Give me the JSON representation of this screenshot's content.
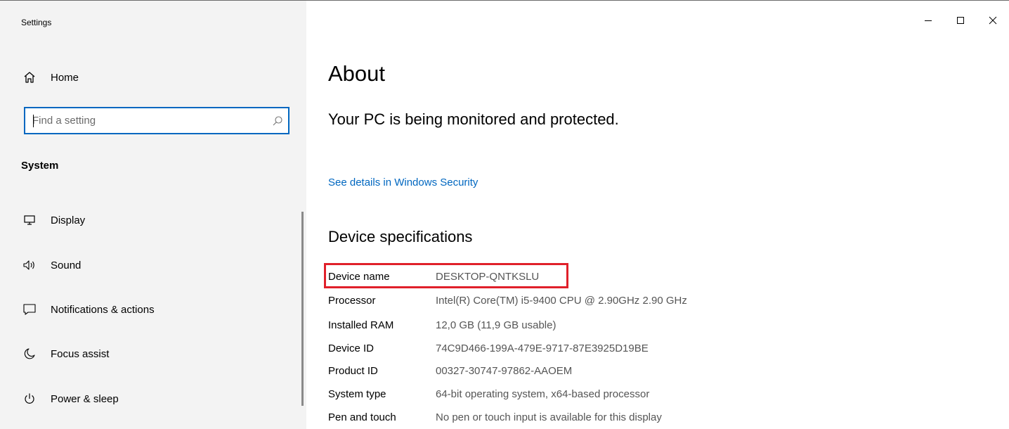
{
  "window": {
    "title": "Settings",
    "controls": {
      "minimize_icon": "minimize-icon",
      "maximize_icon": "maximize-icon",
      "close_icon": "close-icon"
    }
  },
  "sidebar": {
    "home_label": "Home",
    "search": {
      "placeholder": "Find a setting",
      "value": ""
    },
    "section_title": "System",
    "items": [
      {
        "label": "Display",
        "icon": "display-icon"
      },
      {
        "label": "Sound",
        "icon": "sound-icon"
      },
      {
        "label": "Notifications & actions",
        "icon": "notifications-icon"
      },
      {
        "label": "Focus assist",
        "icon": "focus-assist-icon"
      },
      {
        "label": "Power & sleep",
        "icon": "power-icon"
      }
    ]
  },
  "main": {
    "title": "About",
    "status": "Your PC is being monitored and protected.",
    "security_link": "See details in Windows Security",
    "specs_title": "Device specifications",
    "specs": [
      {
        "key": "Device name",
        "value": "DESKTOP-QNTKSLU"
      },
      {
        "key": "Processor",
        "value": "Intel(R) Core(TM) i5-9400 CPU @ 2.90GHz   2.90 GHz"
      },
      {
        "key": "Installed RAM",
        "value": "12,0 GB (11,9 GB usable)"
      },
      {
        "key": "Device ID",
        "value": "74C9D466-199A-479E-9717-87E3925D19BE"
      },
      {
        "key": "Product ID",
        "value": "00327-30747-97862-AAOEM"
      },
      {
        "key": "System type",
        "value": "64-bit operating system, x64-based processor"
      },
      {
        "key": "Pen and touch",
        "value": "No pen or touch input is available for this display"
      }
    ]
  },
  "colors": {
    "accent": "#0067c0",
    "highlight": "#e0202a",
    "sidebar_bg": "#f3f3f3"
  }
}
